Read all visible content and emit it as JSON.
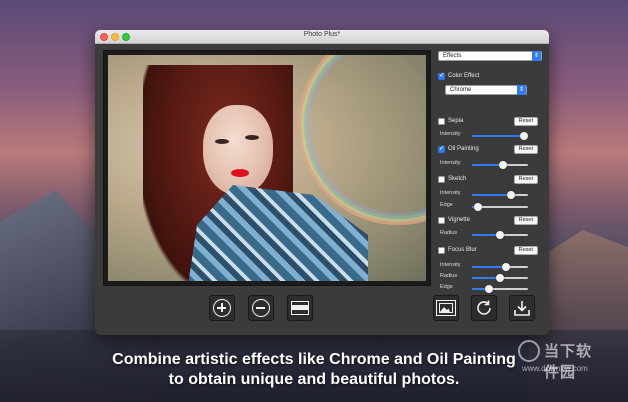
{
  "window": {
    "title": "Photo Plus*"
  },
  "sidebar": {
    "category_select": {
      "value": "Effects"
    },
    "color_effect": {
      "label": "Color Effect",
      "checked": true,
      "preset": "Chrome"
    },
    "effects": [
      {
        "label": "Sepia",
        "checked": false,
        "reset": "Reset",
        "sliders": [
          {
            "label": "Intensity",
            "value": 0.93
          }
        ]
      },
      {
        "label": "Oil Painting",
        "checked": true,
        "reset": "Reset",
        "sliders": [
          {
            "label": "Intensity",
            "value": 0.55
          }
        ]
      },
      {
        "label": "Sketch",
        "checked": false,
        "reset": "Reset",
        "sliders": [
          {
            "label": "Intensity",
            "value": 0.7
          },
          {
            "label": "Edge",
            "value": 0.1
          }
        ]
      },
      {
        "label": "Vignette",
        "checked": false,
        "reset": "Reset",
        "sliders": [
          {
            "label": "Radius",
            "value": 0.5
          }
        ]
      },
      {
        "label": "Focus Blur",
        "checked": false,
        "reset": "Reset",
        "sliders": [
          {
            "label": "Intensity",
            "value": 0.6
          },
          {
            "label": "Radius",
            "value": 0.5
          },
          {
            "label": "Edge",
            "value": 0.3
          }
        ]
      }
    ]
  },
  "toolbar": {
    "left": [
      {
        "icon": "zoom-in-icon"
      },
      {
        "icon": "zoom-out-icon"
      },
      {
        "icon": "fit-screen-icon"
      }
    ],
    "right": [
      {
        "icon": "image-compare-icon"
      },
      {
        "icon": "rotate-icon"
      },
      {
        "icon": "download-icon"
      }
    ]
  },
  "caption": {
    "line1": "Combine artistic effects like Chrome and Oil Painting",
    "line2": "to obtain unique and beautiful photos."
  },
  "watermark": {
    "text": "当下软件园",
    "url": "www.downxia.com"
  },
  "colors": {
    "accent": "#2f7df6",
    "window_bg": "#3b3b3b"
  }
}
